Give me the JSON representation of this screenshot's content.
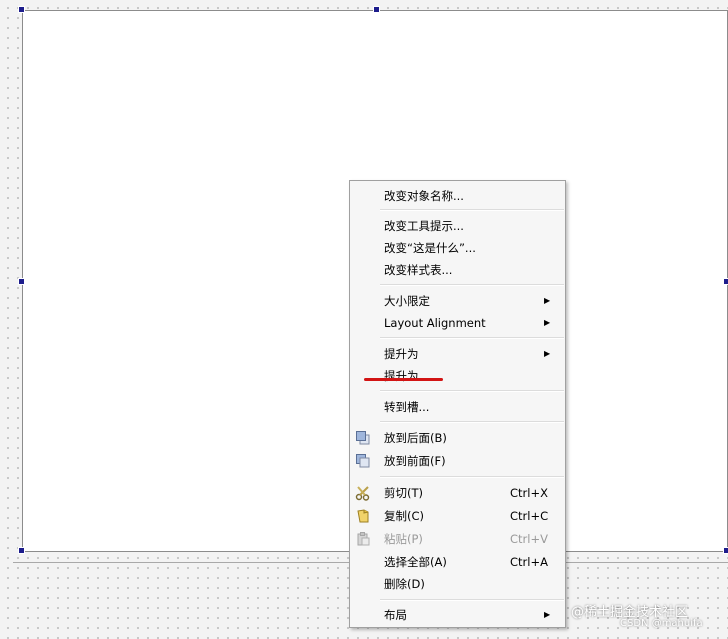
{
  "menu": {
    "rename": "改变对象名称...",
    "tooltip": "改变工具提示...",
    "whats_this": "改变“这是什么”...",
    "stylesheet": "改变样式表...",
    "size_constraints": "大小限定",
    "layout_alignment": "Layout Alignment",
    "promote_to_sub": "提升为",
    "promote_to": "提升为...",
    "go_to_slot": "转到槽...",
    "send_to_back": "放到后面(B)",
    "bring_to_front": "放到前面(F)",
    "cut": "剪切(T)",
    "cut_shortcut": "Ctrl+X",
    "copy": "复制(C)",
    "copy_shortcut": "Ctrl+C",
    "paste": "粘贴(P)",
    "paste_shortcut": "Ctrl+V",
    "select_all": "选择全部(A)",
    "select_all_shortcut": "Ctrl+A",
    "delete": "删除(D)",
    "layout": "布局",
    "submenu_arrow": "▶"
  },
  "icons": {
    "send_to_back": "send-to-back-icon",
    "bring_to_front": "bring-to-front-icon",
    "cut": "scissors-icon",
    "copy": "copy-icon",
    "paste": "paste-icon"
  },
  "colors": {
    "annotation": "#d21414",
    "disabled_text": "#9a9a9a",
    "handle": "#1d1d8c"
  },
  "watermark": {
    "line1": "@稀土掘金技术社区",
    "line2": "CSDN @mahuifa"
  }
}
